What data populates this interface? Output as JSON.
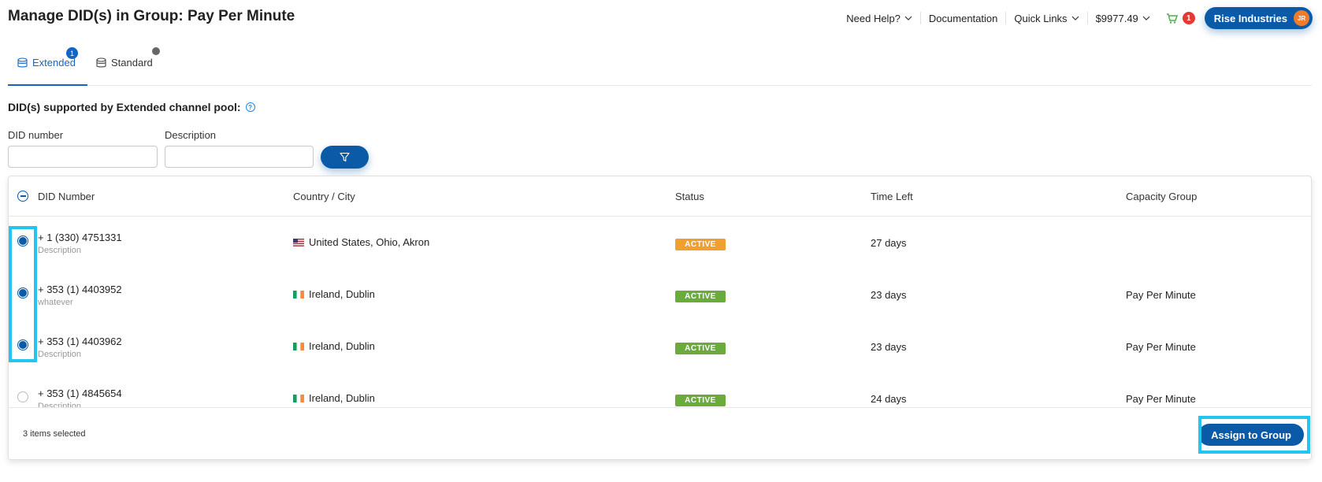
{
  "page": {
    "title": "Manage DID(s) in Group: Pay Per Minute"
  },
  "topnav": {
    "help": "Need Help?",
    "documentation": "Documentation",
    "quick_links": "Quick Links",
    "balance": "$9977.49",
    "cart_count": "1",
    "account": "Rise Industries",
    "avatar_initials": "JR"
  },
  "tabs": [
    {
      "label": "Extended",
      "badge": "1",
      "active": true
    },
    {
      "label": "Standard",
      "active": false
    }
  ],
  "section": {
    "title": "DID(s) supported by Extended channel pool:"
  },
  "filters": {
    "did_label": "DID number",
    "did_value": "",
    "desc_label": "Description",
    "desc_value": ""
  },
  "table": {
    "headers": [
      "DID Number",
      "Country / City",
      "Status",
      "Time Left",
      "Capacity Group"
    ],
    "rows": [
      {
        "checked": true,
        "did": "+ 1 (330) 4751331",
        "desc": "Description",
        "flag": "us",
        "location": "United States, Ohio, Akron",
        "status": "ACTIVE",
        "status_color": "#f0a030",
        "time_left": "27 days",
        "group": ""
      },
      {
        "checked": true,
        "did": "+ 353 (1) 4403952",
        "desc": "whatever",
        "flag": "ie",
        "location": "Ireland, Dublin",
        "status": "ACTIVE",
        "status_color": "#6aab3c",
        "time_left": "23 days",
        "group": "Pay Per Minute"
      },
      {
        "checked": true,
        "did": "+ 353 (1) 4403962",
        "desc": "Description",
        "flag": "ie",
        "location": "Ireland, Dublin",
        "status": "ACTIVE",
        "status_color": "#6aab3c",
        "time_left": "23 days",
        "group": "Pay Per Minute"
      },
      {
        "checked": false,
        "did": "+ 353 (1) 4845654",
        "desc": "Description",
        "flag": "ie",
        "location": "Ireland, Dublin",
        "status": "ACTIVE",
        "status_color": "#6aab3c",
        "time_left": "24 days",
        "group": "Pay Per Minute"
      }
    ]
  },
  "footer": {
    "selected_text": "3 items selected",
    "assign_label": "Assign to Group"
  },
  "colors": {
    "primary": "#0a5aa8",
    "highlight": "#22c4f0",
    "cart_badge": "#e53935",
    "active_orange": "#f0a030",
    "active_green": "#6aab3c"
  }
}
